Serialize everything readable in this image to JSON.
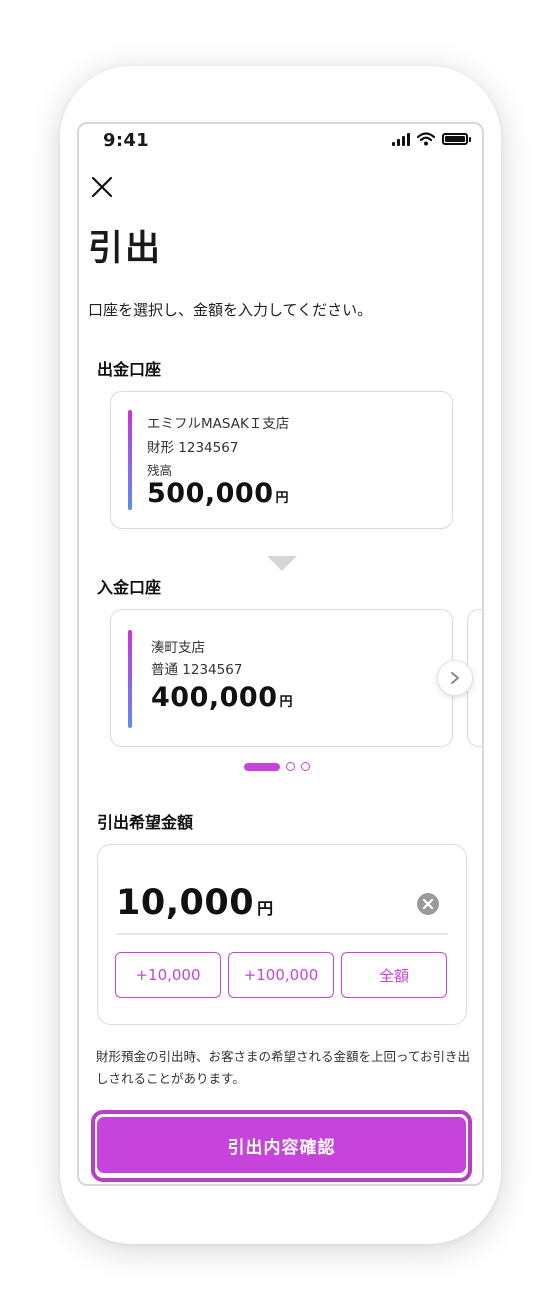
{
  "status_bar": {
    "time": "9:41",
    "icons": [
      "signal-icon",
      "wifi-icon",
      "battery-icon"
    ]
  },
  "header": {
    "close_icon": "close-icon",
    "title": "引出"
  },
  "instruction": "口座を選択し、金額を入力してください。",
  "withdraw_section": {
    "label": "出金口座",
    "card": {
      "branch": "エミフルMASAKＩ支店",
      "account": "財形 1234567",
      "balance_label": "残高",
      "balance": "500,000",
      "currency": "円"
    }
  },
  "deposit_section": {
    "label": "入金口座",
    "card": {
      "branch": "湊町支店",
      "account": "普通 1234567",
      "balance": "400,000",
      "currency": "円"
    },
    "next_icon": "chevron-right-icon",
    "pagination": {
      "total": 3,
      "active": 1
    }
  },
  "amount_section": {
    "label": "引出希望金額",
    "amount": "10,000",
    "currency": "円",
    "quick_buttons": [
      "+10,000",
      "+100,000",
      "全額"
    ]
  },
  "note": "財形預金の引出時、お客さまの希望される金額を上回ってお引き出しされることがあります。",
  "confirm_button": "引出内容確認",
  "colors": {
    "accent": "#c744dc",
    "border": "#dcdcdc",
    "text": "#1a1a1a"
  }
}
